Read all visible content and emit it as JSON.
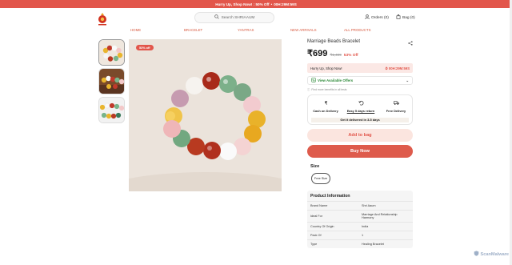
{
  "promo": {
    "text": "Hurry Up, Shop Now! : 50% Off",
    "sep": "•",
    "timer": "00H:29M:59S"
  },
  "header": {
    "search_placeholder": "Search SHRIAAUM",
    "orders_label": "Orders (0)",
    "bag_label": "Bag (0)"
  },
  "menu": {
    "items": [
      "HOME",
      "BRACELET",
      "YANTRAS",
      "NEW ARRIVALS",
      "ALL PRODUCTS"
    ]
  },
  "product": {
    "discount_badge": "53% off",
    "title": "Marriage Beads Bracelet",
    "price": "₹699",
    "mrp": "₹1,499",
    "off": "53% Off",
    "hurry_text": "Hurry Up, Shop Now!",
    "hurry_timer": "00H:29M:59S",
    "offers_label": "View Available Offers",
    "hint": "Find more benefits in all tests",
    "features": [
      "Cash on Delivery",
      "Easy 5 days return",
      "Free Delivery"
    ],
    "delivery_strip": "Get it delivered in 3-5 days",
    "add_to_bag": "Add to bag",
    "buy_now": "Buy Now",
    "size_label": "Size",
    "size_value": "Free Size",
    "info_title": "Product Information",
    "info_rows": [
      {
        "k": "Brand Name",
        "v": "Shri Aaum"
      },
      {
        "k": "Ideal For",
        "v": "Marriage And Relationship Harmony"
      },
      {
        "k": "Country Of Origin",
        "v": "India"
      },
      {
        "k": "Pack Of",
        "v": "1"
      },
      {
        "k": "Type",
        "v": "Healing Bracelet"
      }
    ]
  },
  "watermark": "ScanMalware",
  "colors": {
    "accent": "#e2564b",
    "green": "#2f8a3a"
  }
}
